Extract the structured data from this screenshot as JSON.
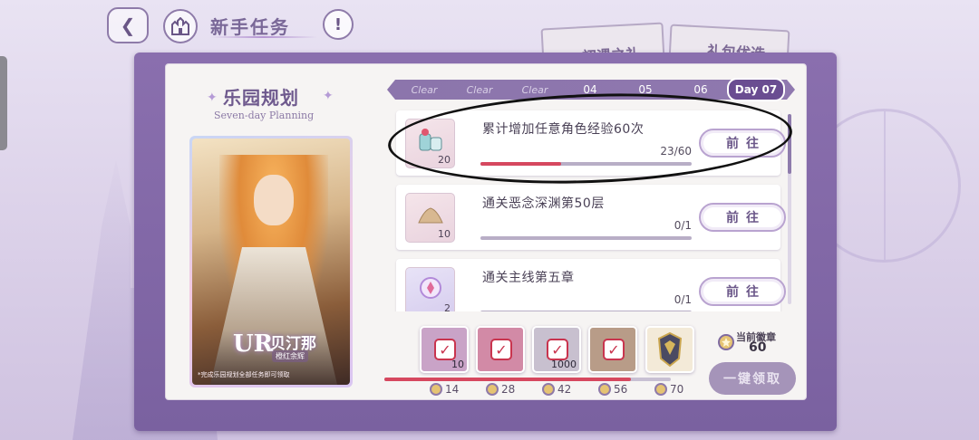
{
  "header": {
    "title": "新手任务",
    "back_icon": "back-arrow-icon",
    "home_icon": "castle-home-icon",
    "info_icon": "info-icon",
    "info_symbol": "!"
  },
  "back_tabs": {
    "first": "初遇之礼",
    "second": "礼包优选"
  },
  "plan": {
    "title": "乐园规划",
    "subtitle": "Seven-day Planning"
  },
  "hero_card": {
    "rarity": "UR",
    "name": "贝汀那",
    "epithet": "橙红余辉",
    "note": "*完成乐园规划全部任务即可领取"
  },
  "days": [
    {
      "label": "Clear",
      "state": "clear"
    },
    {
      "label": "Clear",
      "state": "clear"
    },
    {
      "label": "Clear",
      "state": "clear"
    },
    {
      "label": "04",
      "state": "normal"
    },
    {
      "label": "05",
      "state": "normal"
    },
    {
      "label": "06",
      "state": "normal"
    },
    {
      "label": "Day 07",
      "state": "active"
    }
  ],
  "tasks": [
    {
      "text": "累计增加任意角色经验60次",
      "count": "23/60",
      "progress": 0.383,
      "reward_qty": "20",
      "icon": "exp-potion-icon",
      "button": "前往"
    },
    {
      "text": "通关恶念深渊第50层",
      "count": "0/1",
      "progress": 0,
      "reward_qty": "10",
      "icon": "sand-pile-icon",
      "button": "前往"
    },
    {
      "text": "通关主线第五章",
      "count": "0/1",
      "progress": 0,
      "reward_qty": "2",
      "icon": "crystal-ball-icon",
      "button": "前往"
    }
  ],
  "rewards": [
    {
      "qty": "10",
      "icon": "ticket-icon",
      "bg": "#c9a3c7"
    },
    {
      "qty": "",
      "icon": "gift-bag-icon",
      "bg": "#d28aa6"
    },
    {
      "qty": "1000",
      "icon": "gem-icon",
      "bg": "#c8c0cf"
    },
    {
      "qty": "",
      "icon": "card-stack-icon",
      "bg": "#b89c88"
    },
    {
      "qty": "",
      "icon": "armor-icon",
      "bg": "#f3ead8"
    }
  ],
  "milestones": [
    "14",
    "28",
    "42",
    "56",
    "70"
  ],
  "milestone_progress": 0.86,
  "badge": {
    "label": "当前徽章",
    "value": "60",
    "icon": "medal-icon"
  },
  "claim_button": "一键领取",
  "colors": {
    "accent": "#7a61a0",
    "progress": "#d6485f",
    "paper": "#f6f4f3"
  }
}
